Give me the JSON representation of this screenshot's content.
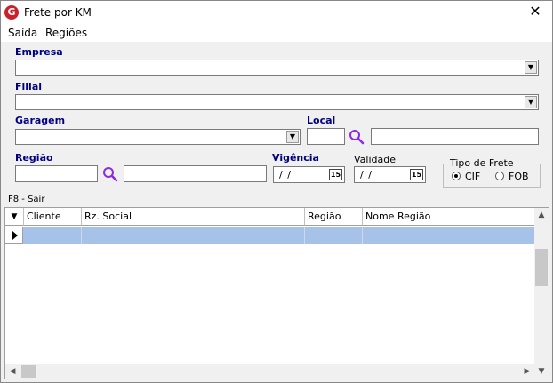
{
  "window": {
    "title": "Frete por KM",
    "icon_letter": "G",
    "close_glyph": "✕"
  },
  "menu": [
    {
      "label": "Saída"
    },
    {
      "label": "Regiões"
    }
  ],
  "form": {
    "empresa": {
      "label": "Empresa",
      "value": ""
    },
    "filial": {
      "label": "Filial",
      "value": ""
    },
    "garagem": {
      "label": "Garagem",
      "value": ""
    },
    "local": {
      "label": "Local",
      "code": "",
      "description": ""
    },
    "regiao": {
      "label": "Região",
      "code": "",
      "description": ""
    },
    "vigencia": {
      "label": "Vigência",
      "value": "/ /",
      "cal_glyph": "15"
    },
    "validade": {
      "label": "Validade",
      "value": "/ /",
      "cal_glyph": "15"
    },
    "tipo_frete": {
      "title": "Tipo de Frete",
      "options": [
        {
          "label": "CIF",
          "selected": true
        },
        {
          "label": "FOB",
          "selected": false
        }
      ]
    }
  },
  "hint": "F8 - Sair",
  "grid": {
    "columns": [
      {
        "label": "Cliente"
      },
      {
        "label": "Rz. Social"
      },
      {
        "label": "Região"
      },
      {
        "label": "Nome Região"
      }
    ],
    "rows": [
      {
        "cliente": "",
        "rz_social": "",
        "regiao": "",
        "nome_regiao": ""
      }
    ],
    "selection_color": "#a7c2e8"
  },
  "icons": {
    "search": "magnifier-icon",
    "app": "app-logo-icon"
  }
}
